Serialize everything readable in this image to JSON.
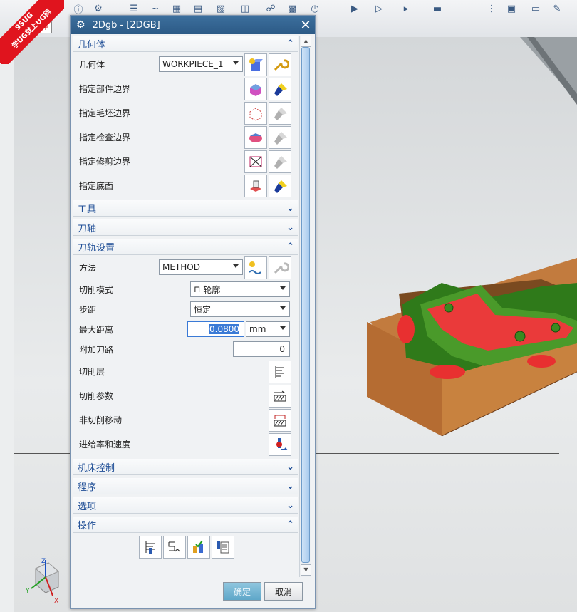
{
  "watermark": {
    "line1": "9SUG",
    "line2": "学UG就上UG网"
  },
  "dialog": {
    "title": "2Dgb - [2DGB]",
    "ok_label": "确定",
    "cancel_label": "取消"
  },
  "sections": {
    "geometry": {
      "header": "几何体",
      "geometry_label": "几何体",
      "geometry_value": "WORKPIECE_1",
      "part_boundary": "指定部件边界",
      "blank_boundary": "指定毛坯边界",
      "check_boundary": "指定检查边界",
      "trim_boundary": "指定修剪边界",
      "floor": "指定底面"
    },
    "tool": {
      "header": "工具"
    },
    "axis": {
      "header": "刀轴"
    },
    "path": {
      "header": "刀轨设置",
      "method_label": "方法",
      "method_value": "METHOD",
      "cut_pattern_label": "切削模式",
      "cut_pattern_value": "轮廓",
      "stepover_label": "步距",
      "stepover_value": "恒定",
      "max_distance_label": "最大距离",
      "max_distance_value": "0.0800",
      "max_distance_unit": "mm",
      "additional_passes_label": "附加刀路",
      "additional_passes_value": "0",
      "cut_levels_label": "切削层",
      "cut_params_label": "切削参数",
      "non_cut_moves_label": "非切削移动",
      "feeds_speeds_label": "进给率和速度"
    },
    "machine": {
      "header": "机床控制"
    },
    "program": {
      "header": "程序"
    },
    "options": {
      "header": "选项"
    },
    "actions": {
      "header": "操作"
    }
  },
  "triad": {
    "z": "Z",
    "y": "Y",
    "x": "X"
  },
  "icons": [
    "gear-icon",
    "close-icon",
    "geometry-new-icon",
    "wrench-icon",
    "part-boundary-icon",
    "flashlight-icon",
    "blank-boundary-icon",
    "check-boundary-icon",
    "trim-boundary-icon",
    "floor-icon",
    "method-new-icon",
    "cut-levels-icon",
    "cut-params-icon",
    "non-cut-moves-icon",
    "feeds-speeds-icon",
    "generate-icon",
    "replay-icon",
    "verify-icon",
    "list-icon",
    "contour-icon"
  ]
}
